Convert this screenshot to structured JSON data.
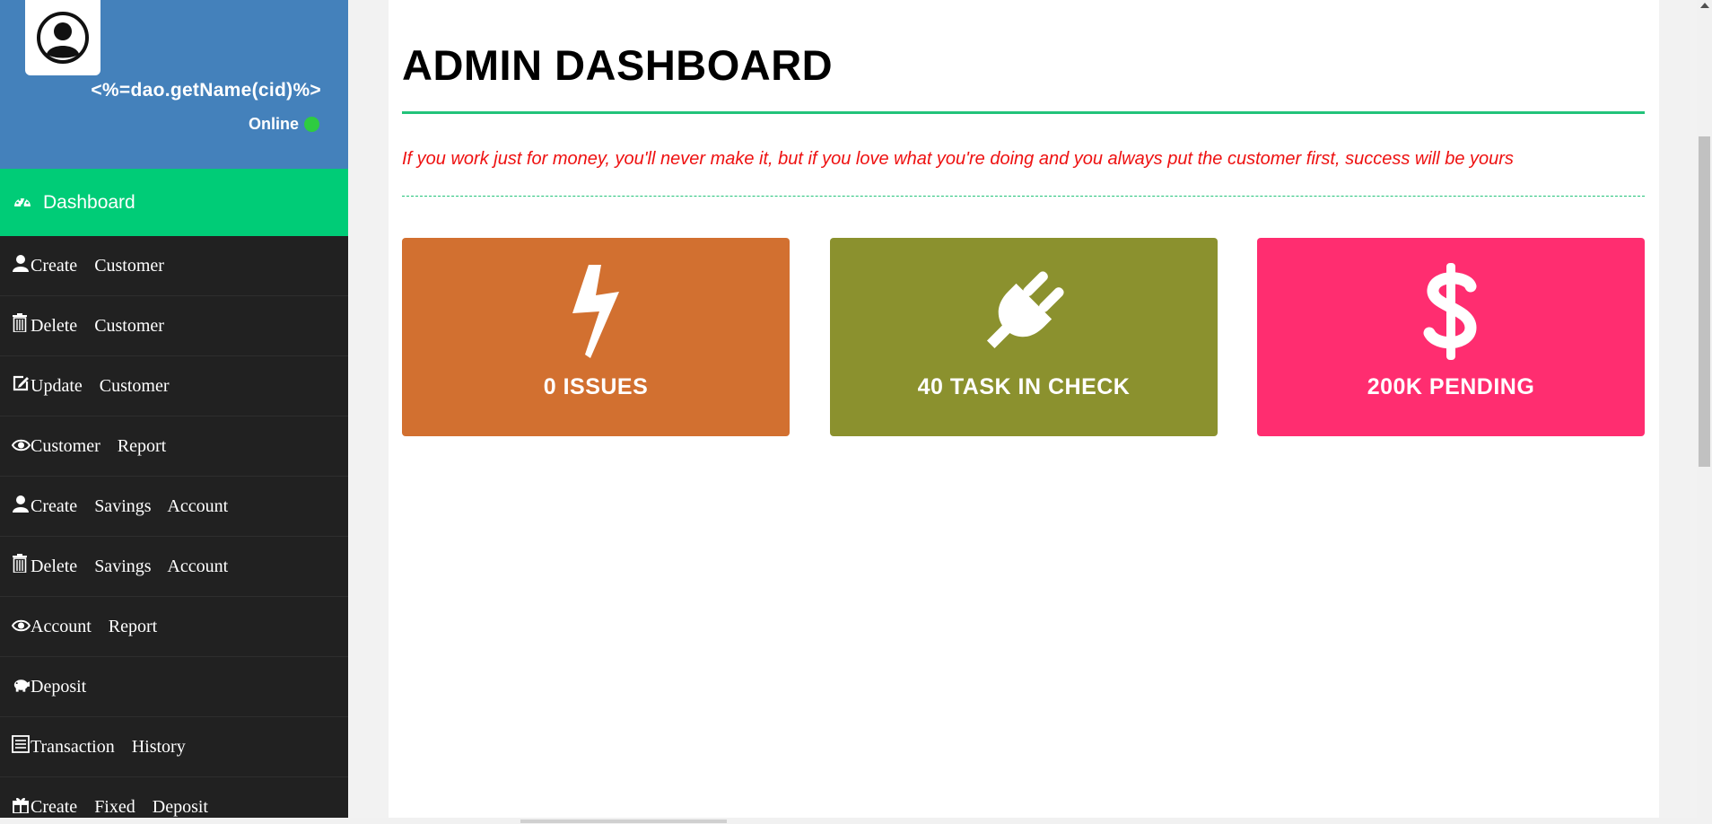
{
  "profile": {
    "name": "<%=dao.getName(cid)%>",
    "status": "Online",
    "status_color": "#2ecc40",
    "background": "#4481bb",
    "avatar_icon": "user-circle-icon"
  },
  "sidebar": {
    "active_item": {
      "label": "Dashboard",
      "icon": "dashboard-gauge-icon",
      "color": "#00cc77"
    },
    "items": [
      {
        "label": "Create Customer",
        "icon": "user-icon"
      },
      {
        "label": "Delete Customer",
        "icon": "trash-icon"
      },
      {
        "label": "Update Customer",
        "icon": "edit-icon"
      },
      {
        "label": "Customer Report",
        "icon": "eye-icon"
      },
      {
        "label": "Create Savings Account",
        "icon": "user-icon"
      },
      {
        "label": "Delete Savings Account",
        "icon": "trash-icon"
      },
      {
        "label": "Account Report",
        "icon": "eye-icon"
      },
      {
        "label": "Deposit",
        "icon": "piggy-bank-icon"
      },
      {
        "label": "Transaction History",
        "icon": "list-icon"
      },
      {
        "label": "Create Fixed Deposit",
        "icon": "gift-icon"
      }
    ]
  },
  "main": {
    "title": "ADMIN DASHBOARD",
    "quote": "If you work just for money, you'll never make it, but if you love what you're doing and you always put the customer first, success will be yours",
    "quote_color": "#ee1111",
    "accent_color": "#22c37a",
    "cards": [
      {
        "label": "0 ISSUES",
        "icon": "bolt-icon",
        "color": "#d27030"
      },
      {
        "label": "40 TASK IN CHECK",
        "icon": "plug-icon",
        "color": "#8b912e"
      },
      {
        "label": "200K PENDING",
        "icon": "dollar-icon",
        "color": "#ff2d70"
      }
    ]
  }
}
